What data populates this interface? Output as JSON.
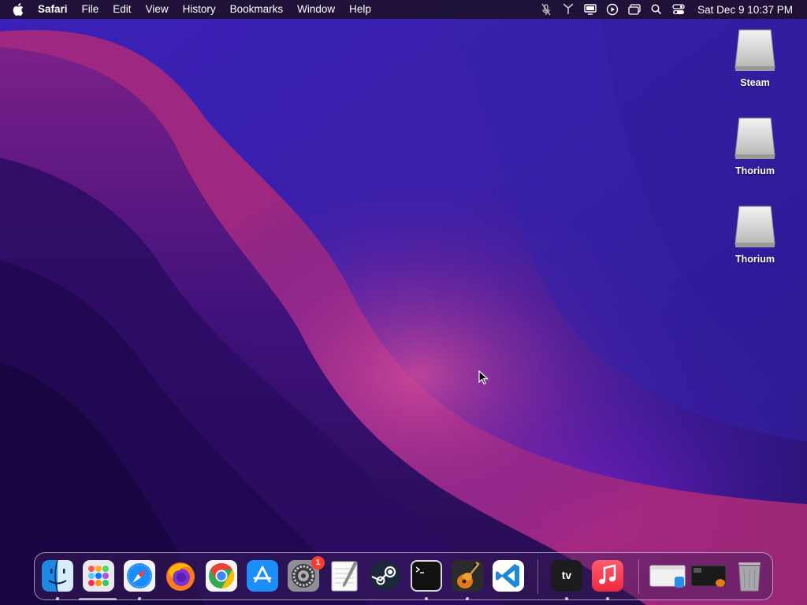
{
  "menubar": {
    "apple_icon": "apple-icon",
    "app_name": "Safari",
    "menus": [
      "File",
      "Edit",
      "View",
      "History",
      "Bookmarks",
      "Window",
      "Help"
    ],
    "status_icons": [
      "mic-off-icon",
      "wifi-icon",
      "display-icon",
      "play-circle-icon",
      "window-icon",
      "search-icon",
      "control-center-icon"
    ],
    "clock": "Sat Dec 9  10:37 PM"
  },
  "desktop": {
    "icons": [
      {
        "label": "Steam",
        "icon": "drive-icon"
      },
      {
        "label": "Thorium",
        "icon": "drive-icon"
      },
      {
        "label": "Thorium",
        "icon": "drive-icon"
      }
    ]
  },
  "dock": {
    "apps": [
      {
        "name": "finder-icon",
        "running": true
      },
      {
        "name": "launchpad-icon",
        "running": true
      },
      {
        "name": "safari-icon",
        "running": true
      },
      {
        "name": "firefox-icon",
        "running": false
      },
      {
        "name": "chrome-icon",
        "running": false
      },
      {
        "name": "app-store-icon",
        "running": false
      },
      {
        "name": "system-settings-icon",
        "running": false,
        "badge": "1"
      },
      {
        "name": "textedit-icon",
        "running": false
      },
      {
        "name": "steam-icon",
        "running": false
      },
      {
        "name": "terminal-icon",
        "running": true
      },
      {
        "name": "garageband-icon",
        "running": true
      },
      {
        "name": "vscode-icon",
        "running": false
      },
      {
        "name": "apple-tv-icon",
        "running": true
      },
      {
        "name": "music-icon",
        "running": true
      },
      {
        "name": "minimized-window-1-icon",
        "running": false
      },
      {
        "name": "minimized-window-2-icon",
        "running": false
      },
      {
        "name": "trash-icon",
        "running": false
      }
    ],
    "tv_label": "tv"
  },
  "colors": {
    "wallpaper_top": "#3a1ea8",
    "wallpaper_pink": "#c2307a",
    "badge": "#ff3b30"
  }
}
